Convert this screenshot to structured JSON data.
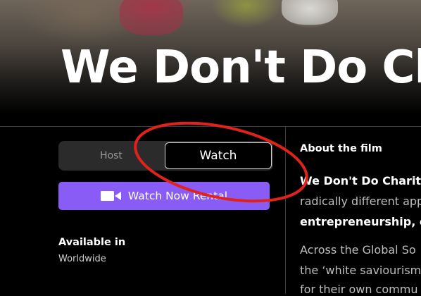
{
  "film": {
    "title": "We Don't Do Charity"
  },
  "toggle": {
    "host_label": "Host",
    "watch_label": "Watch"
  },
  "cta": {
    "label": "Watch Now Rental"
  },
  "availability": {
    "label": "Available in",
    "value": "Worldwide"
  },
  "about": {
    "heading": "About the film",
    "lines": [
      "We Don't Do Charity",
      "radically different app",
      "entrepreneurship, co",
      "Across the Global So",
      "the ‘white saviourism",
      "for their own commu"
    ]
  },
  "colors": {
    "accent": "#8a5cf6",
    "annotation": "#e0221b",
    "background": "#000000"
  }
}
